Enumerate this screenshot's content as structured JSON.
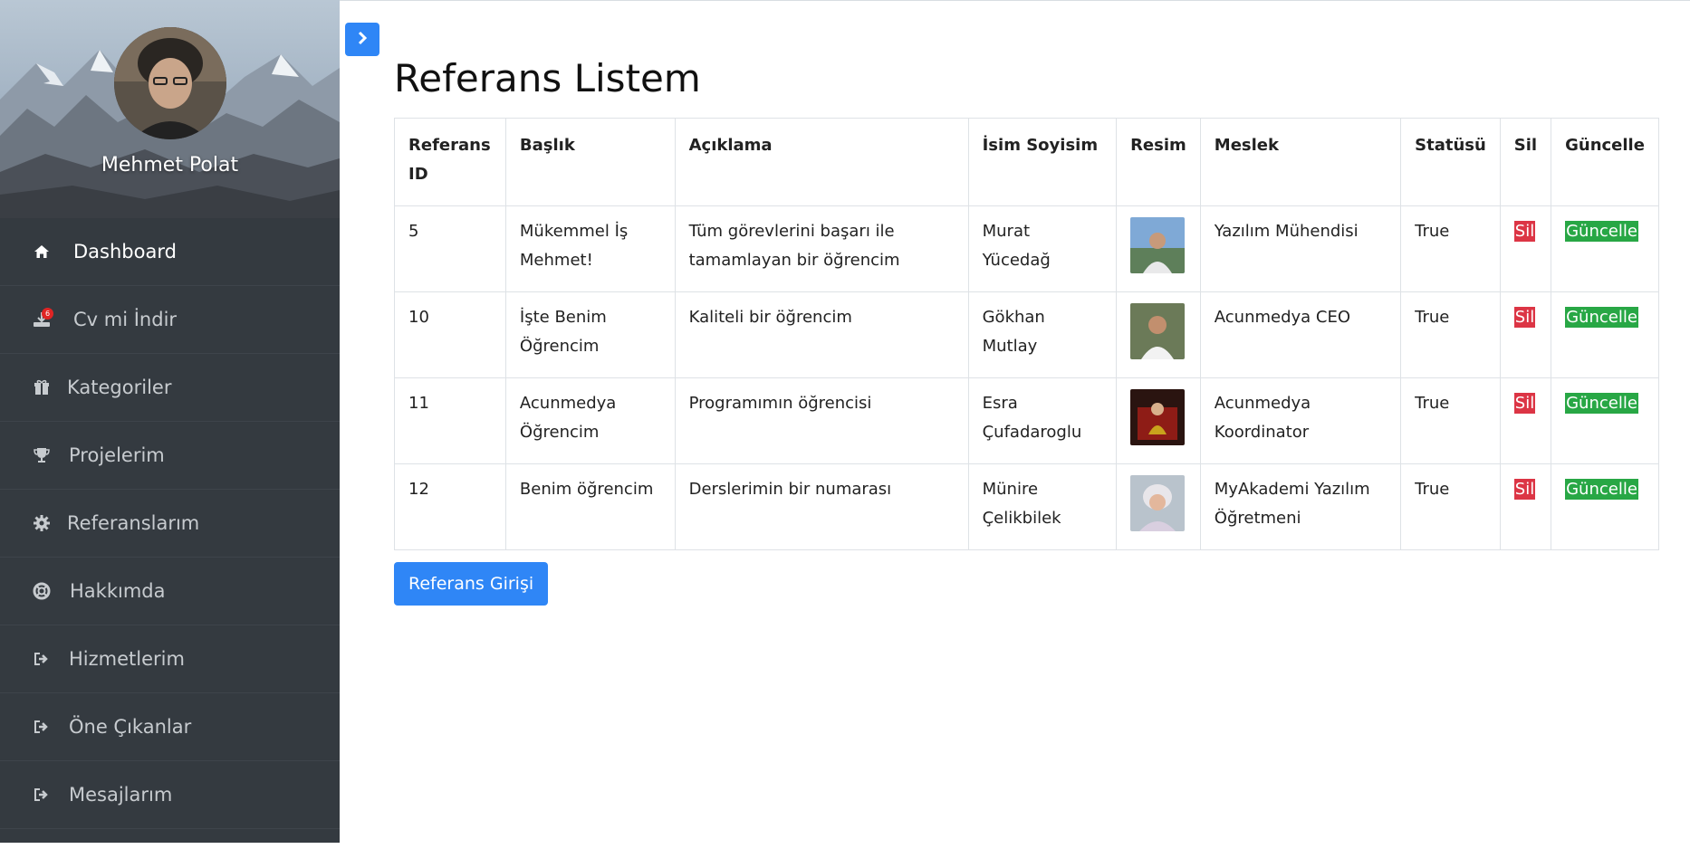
{
  "profile": {
    "name": "Mehmet Polat"
  },
  "sidebar": {
    "items": [
      {
        "label": "Dashboard",
        "icon": "home-icon",
        "active": true
      },
      {
        "label": "Cv mi İndir",
        "icon": "download-icon",
        "badge": "6"
      },
      {
        "label": "Kategoriler",
        "icon": "gift-icon"
      },
      {
        "label": "Projelerim",
        "icon": "trophy-icon"
      },
      {
        "label": "Referanslarım",
        "icon": "gear-icon"
      },
      {
        "label": "Hakkımda",
        "icon": "life-ring-icon"
      },
      {
        "label": "Hizmetlerim",
        "icon": "sign-out-icon"
      },
      {
        "label": "Öne Çıkanlar",
        "icon": "sign-out-icon"
      },
      {
        "label": "Mesajlarım",
        "icon": "sign-out-icon"
      }
    ]
  },
  "page": {
    "title": "Referans Listem"
  },
  "table": {
    "headers": [
      "Referans ID",
      "Başlık",
      "Açıklama",
      "İsim Soyisim",
      "Resim",
      "Meslek",
      "Statüsü",
      "Sil",
      "Güncelle"
    ],
    "rows": [
      {
        "id": "5",
        "title": "Mükemmel İş Mehmet!",
        "desc": "Tüm görevlerini başarı ile tamamlayan bir öğrencim",
        "name": "Murat Yücedağ",
        "job": "Yazılım Mühendisi",
        "status": "True",
        "delete": "Sil",
        "update": "Güncelle"
      },
      {
        "id": "10",
        "title": "İşte Benim Öğrencim",
        "desc": "Kaliteli bir öğrencim",
        "name": "Gökhan Mutlay",
        "job": "Acunmedya CEO",
        "status": "True",
        "delete": "Sil",
        "update": "Güncelle"
      },
      {
        "id": "11",
        "title": "Acunmedya Öğrencim",
        "desc": "Programımın öğrencisi",
        "name": "Esra Çufadaroglu",
        "job": "Acunmedya Koordinator",
        "status": "True",
        "delete": "Sil",
        "update": "Güncelle"
      },
      {
        "id": "12",
        "title": "Benim öğrencim",
        "desc": "Derslerimin bir numarası",
        "name": "Münire Çelikbilek",
        "job": "MyAkademi Yazılım Öğretmeni",
        "status": "True",
        "delete": "Sil",
        "update": "Güncelle"
      }
    ]
  },
  "actions": {
    "add_label": "Referans Girişi"
  },
  "colors": {
    "sidebar": "#343a40",
    "primary": "#2f86f6",
    "danger": "#dc3545",
    "success": "#28a745"
  }
}
